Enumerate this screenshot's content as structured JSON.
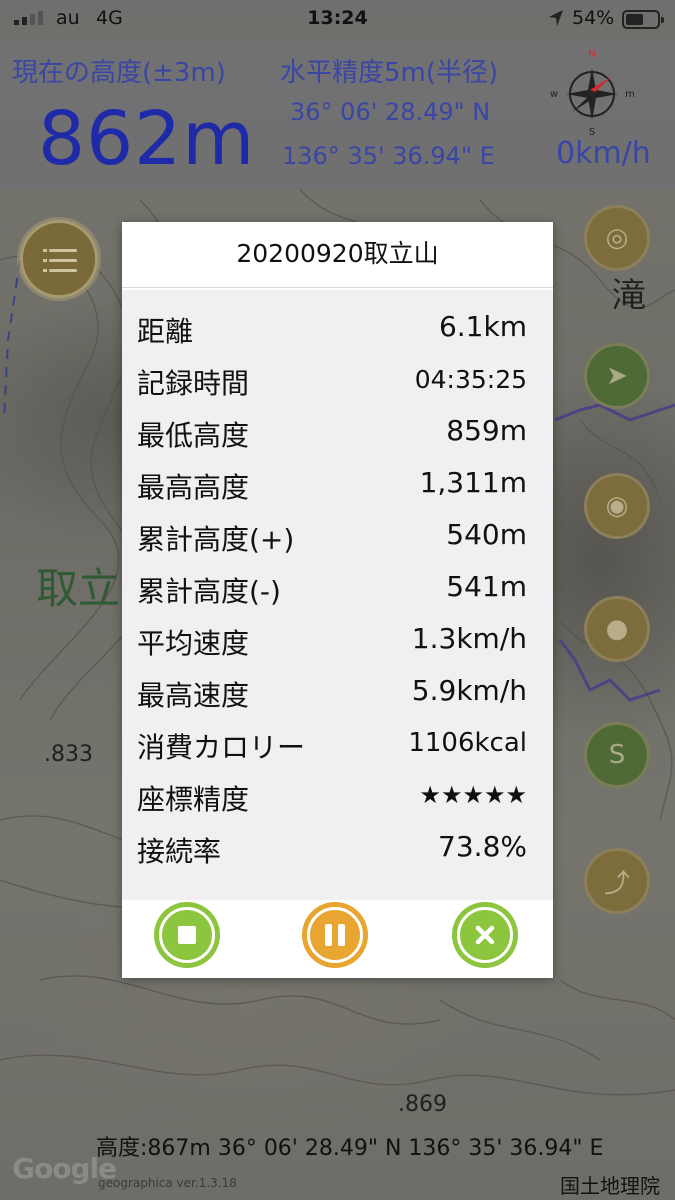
{
  "status_bar": {
    "carrier": "au",
    "network": "4G",
    "time": "13:24",
    "battery_percent": "54%",
    "icons": [
      "signal-icon",
      "location-arrow-icon",
      "battery-icon"
    ]
  },
  "header": {
    "altitude_title": "現在の高度(±3m)",
    "altitude_value": "862m",
    "accuracy_title": "水平精度5m(半径)",
    "latitude": "36° 06' 28.49\" N",
    "longitude": "136° 35' 36.94\" E",
    "speed": "0km/h",
    "compass_labels": {
      "n": "N",
      "s": "S",
      "e": "m",
      "w": "w"
    }
  },
  "map": {
    "labels": [
      "滝",
      "取立",
      ".833",
      ".869"
    ]
  },
  "dialog": {
    "title": "20200920取立山",
    "stats": [
      {
        "label": "距離",
        "value": "6.1km"
      },
      {
        "label": "記録時間",
        "value": "04:35:25"
      },
      {
        "label": "最低高度",
        "value": "859m"
      },
      {
        "label": "最高高度",
        "value": "1,311m"
      },
      {
        "label": "累計高度(+)",
        "value": "540m"
      },
      {
        "label": "累計高度(-)",
        "value": "541m"
      },
      {
        "label": "平均速度",
        "value": "1.3km/h"
      },
      {
        "label": "最高速度",
        "value": "5.9km/h"
      },
      {
        "label": "消費カロリー",
        "value": "1106kcal"
      },
      {
        "label": "座標精度",
        "value": "★★★★★"
      },
      {
        "label": "接続率",
        "value": "73.8%"
      }
    ],
    "buttons": [
      {
        "name": "stop",
        "icon": "stop-icon",
        "color": "#8cc63e"
      },
      {
        "name": "pause",
        "icon": "pause-icon",
        "color": "#e8a530"
      },
      {
        "name": "close",
        "icon": "close-icon",
        "color": "#8cc63e"
      }
    ]
  },
  "footer": {
    "coord_line": "高度:867m  36° 06' 28.49\" N 136° 35' 36.94\" E",
    "google_logo": "Google",
    "version": "geographica ver.1.3.18",
    "credit": "国土地理院"
  }
}
